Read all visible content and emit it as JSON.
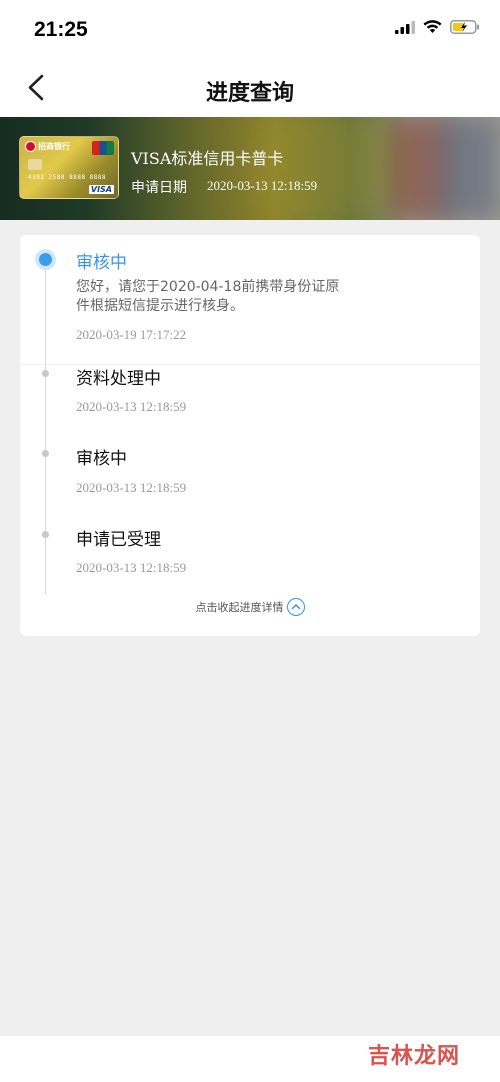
{
  "status_bar": {
    "time": "21:25"
  },
  "nav": {
    "title": "进度查询"
  },
  "card": {
    "bank_name": "招商银行",
    "card_number": "4392 2588 8888 8888",
    "name": "VISA标准信用卡普卡",
    "apply_date_label": "申请日期",
    "apply_date_value": "2020-03-13 12:18:59"
  },
  "timeline": [
    {
      "title": "审核中",
      "message": "您好，请您于2020-04-18前携带身份证原件根据短信提示进行核身。",
      "time": "2020-03-19 17:17:22",
      "active": true
    },
    {
      "title": "资料处理中",
      "time": "2020-03-13 12:18:59",
      "active": false
    },
    {
      "title": "审核中",
      "time": "2020-03-13 12:18:59",
      "active": false
    },
    {
      "title": "申请已受理",
      "time": "2020-03-13 12:18:59",
      "active": false
    }
  ],
  "collapse_label": "点击收起进度详情",
  "watermark": "吉林龙网",
  "colors": {
    "accent": "#3a93e6",
    "page_bg": "#efefef"
  }
}
